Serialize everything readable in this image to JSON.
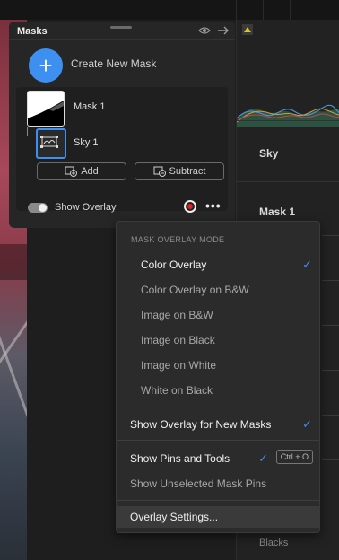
{
  "panel": {
    "title": "Masks",
    "create_label": "Create New Mask",
    "masks": [
      {
        "label": "Mask 1"
      },
      {
        "label": "Sky 1"
      }
    ],
    "add_label": "Add",
    "subtract_label": "Subtract",
    "show_overlay_label": "Show Overlay",
    "show_overlay_on": true
  },
  "right": {
    "sky_label": "Sky",
    "mask_label": "Mask 1",
    "blacks_label": "Blacks"
  },
  "menu": {
    "header": "MASK OVERLAY MODE",
    "modes": [
      {
        "label": "Color Overlay",
        "checked": true
      },
      {
        "label": "Color Overlay on B&W",
        "checked": false
      },
      {
        "label": "Image on B&W",
        "checked": false
      },
      {
        "label": "Image on Black",
        "checked": false
      },
      {
        "label": "Image on White",
        "checked": false
      },
      {
        "label": "White on Black",
        "checked": false
      }
    ],
    "show_overlay_new": {
      "label": "Show Overlay for New Masks",
      "checked": true
    },
    "show_pins": {
      "label": "Show Pins and Tools",
      "checked": true,
      "shortcut": "Ctrl + O"
    },
    "show_unselected": {
      "label": "Show Unselected Mask Pins"
    },
    "overlay_settings": {
      "label": "Overlay Settings..."
    }
  },
  "colors": {
    "accent": "#3d8ff0",
    "record": "#e02020",
    "warning": "#e3c230"
  }
}
